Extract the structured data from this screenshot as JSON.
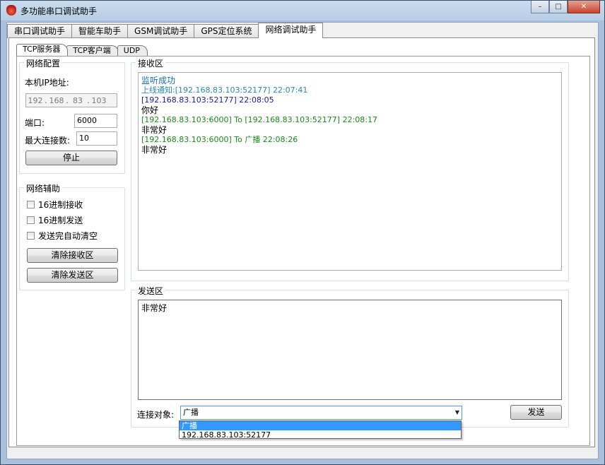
{
  "window": {
    "title": "多功能串口调试助手",
    "buttons": {
      "minimize": "–",
      "maximize": "□",
      "close": "✕"
    }
  },
  "main_tabs": [
    {
      "label": "串口调试助手",
      "active": false
    },
    {
      "label": "智能车助手",
      "active": false
    },
    {
      "label": "GSM调试助手",
      "active": false
    },
    {
      "label": "GPS定位系统",
      "active": false
    },
    {
      "label": "网络调试助手",
      "active": true
    }
  ],
  "sub_tabs": [
    {
      "label": "TCP服务器",
      "active": true
    },
    {
      "label": "TCP客户端",
      "active": false
    },
    {
      "label": "UDP",
      "active": false
    }
  ],
  "network_config": {
    "title": "网络配置",
    "ip_label": "本机IP地址:",
    "ip": [
      "192",
      "168",
      "83",
      "103"
    ],
    "port_label": "端口:",
    "port": "6000",
    "maxconn_label": "最大连接数:",
    "maxconn": "10",
    "stop_button": "停止"
  },
  "network_aux": {
    "title": "网络辅助",
    "hex_recv": "16进制接收",
    "hex_send": "16进制发送",
    "auto_clear": "发送完自动清空",
    "clear_recv_button": "清除接收区",
    "clear_send_button": "清除发送区"
  },
  "receive": {
    "title": "接收区",
    "lines": [
      {
        "text": "监听成功",
        "color": "#1b6cae"
      },
      {
        "text": "上线通知:[192.168.83.103:52177] 22:07:41",
        "color": "#2a8aa8"
      },
      {
        "text": "[192.168.83.103:52177] 22:08:05",
        "color": "#1a1aa0"
      },
      {
        "text": "你好",
        "color": "#000000"
      },
      {
        "text": "[192.168.83.103:6000] To [192.168.83.103:52177] 22:08:17",
        "color": "#1a8a1a"
      },
      {
        "text": "非常好",
        "color": "#000000"
      },
      {
        "text": "[192.168.83.103:6000] To 广播 22:08:26",
        "color": "#1a8a1a"
      },
      {
        "text": "非常好",
        "color": "#000000"
      }
    ]
  },
  "send": {
    "title": "发送区",
    "text": "非常好",
    "target_label": "连接对象:",
    "target_selected": "广播",
    "target_options": [
      "广播",
      "192.168.83.103:52177"
    ],
    "send_button": "发送"
  },
  "colors": {
    "accent": "#3399ff",
    "title_bar": "#b8cde4"
  }
}
